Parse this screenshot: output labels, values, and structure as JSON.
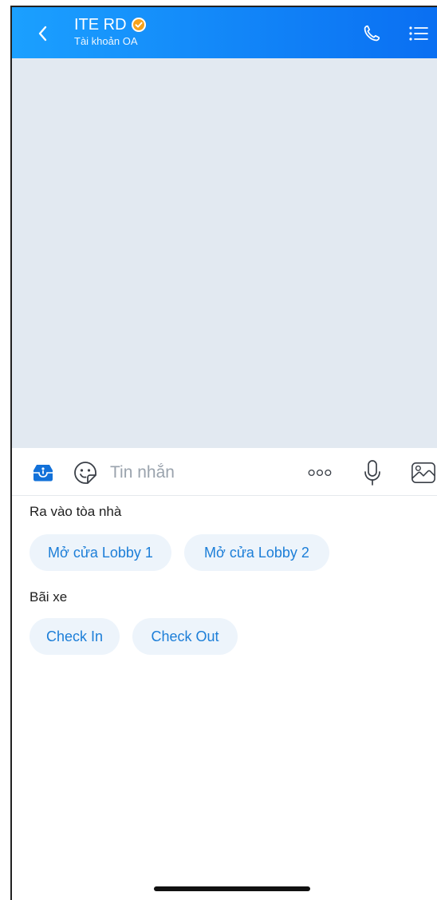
{
  "header": {
    "title": "ITE RD",
    "subtitle": "Tài khoản OA",
    "brand_color": "#0a6ff2",
    "verified_badge_color": "#f6a21b",
    "icons": {
      "back": "chevron-left-icon",
      "call": "phone-icon",
      "menu": "list-menu-icon"
    }
  },
  "chat": {
    "background_color": "#e2e9f1"
  },
  "composer": {
    "placeholder": "Tin nhắn",
    "value": "",
    "icons": {
      "left": "oa-menu-icon",
      "sticker": "sticker-icon",
      "more": "more-dots-icon",
      "mic": "microphone-icon",
      "image": "image-icon"
    }
  },
  "quick_menu": {
    "sections": [
      {
        "title": "Ra vào tòa nhà",
        "buttons": [
          {
            "label": "Mở cửa Lobby 1"
          },
          {
            "label": "Mở cửa Lobby 2"
          }
        ]
      },
      {
        "title": "Bãi xe",
        "buttons": [
          {
            "label": "Check In"
          },
          {
            "label": "Check Out"
          }
        ]
      }
    ],
    "chip_background": "#edf4fb",
    "chip_text_color": "#1c7ed8"
  }
}
